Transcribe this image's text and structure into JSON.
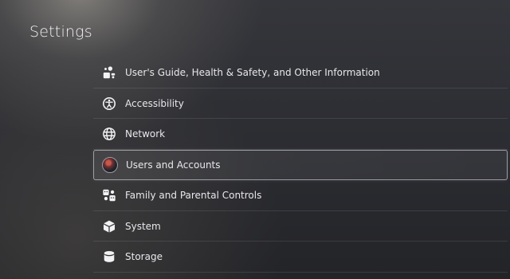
{
  "header": {
    "title": "Settings"
  },
  "menu": {
    "items": [
      {
        "label": "User's Guide, Health & Safety, and Other Information",
        "icon": "guide-icon"
      },
      {
        "label": "Accessibility",
        "icon": "accessibility-icon"
      },
      {
        "label": "Network",
        "icon": "globe-icon"
      },
      {
        "label": "Users and Accounts",
        "icon": "user-avatar",
        "selected": true
      },
      {
        "label": "Family and Parental Controls",
        "icon": "family-icon"
      },
      {
        "label": "System",
        "icon": "cube-icon"
      },
      {
        "label": "Storage",
        "icon": "storage-icon"
      }
    ]
  },
  "colors": {
    "background": "#2f3035",
    "text": "#e8e8ec",
    "selection_border": "#dcdee4"
  }
}
